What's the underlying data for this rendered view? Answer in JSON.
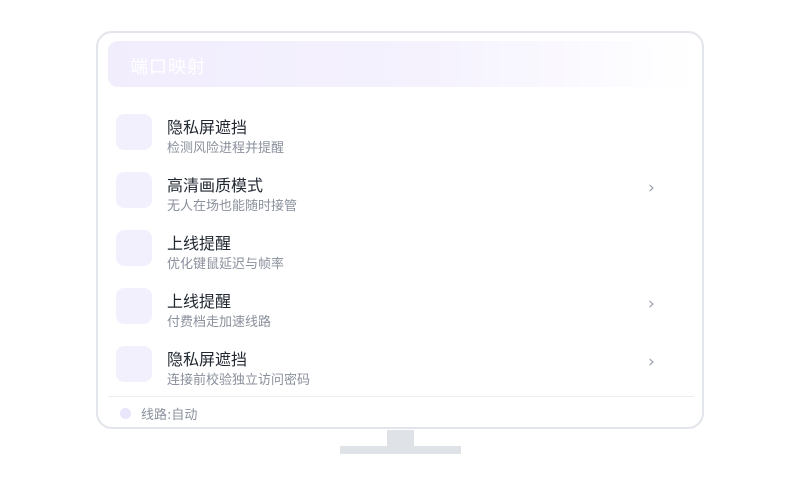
{
  "header": {
    "title": "端口映射"
  },
  "items": [
    {
      "title": "隐私屏遮挡",
      "subtitle": "检测风险进程并提醒",
      "chevron": ""
    },
    {
      "title": "高清画质模式",
      "subtitle": "无人在场也能随时接管",
      "chevron": "›"
    },
    {
      "title": "上线提醒",
      "subtitle": "优化键鼠延迟与帧率",
      "chevron": ""
    },
    {
      "title": "上线提醒",
      "subtitle": "付费档走加速线路",
      "chevron": "›"
    },
    {
      "title": "隐私屏遮挡",
      "subtitle": "连接前校验独立访问密码",
      "chevron": "›"
    }
  ],
  "footer": {
    "status": "线路:自动"
  },
  "colors": {
    "accent_light": "#f1edfd",
    "border": "#e3e5ec",
    "stand": "#dfe2e7"
  }
}
